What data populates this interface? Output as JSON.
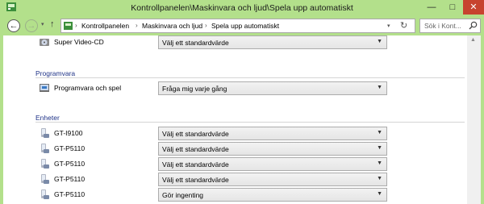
{
  "window": {
    "title": "Kontrollpanelen\\Maskinvara och ljud\\Spela upp automatiskt",
    "minimize_glyph": "—",
    "maximize_glyph": "□",
    "close_glyph": "✕"
  },
  "addressbar": {
    "back_glyph": "←",
    "forward_glyph": "→",
    "up_glyph": "↑",
    "crumbs": [
      "Kontrollpanelen",
      "Maskinvara och ljud",
      "Spela upp automatiskt"
    ],
    "search_placeholder": "Sök i Kont...",
    "refresh_glyph": "↻"
  },
  "sections": {
    "top_row": {
      "label": "Super Video-CD",
      "value": "Välj ett standardvärde",
      "icon": "super-video-cd-icon"
    },
    "software": {
      "title": "Programvara",
      "rows": [
        {
          "label": "Programvara och spel",
          "value": "Fråga mig varje gång",
          "icon": "software-icon"
        }
      ]
    },
    "devices": {
      "title": "Enheter",
      "rows": [
        {
          "label": "GT-I9100",
          "value": "Välj ett standardvärde",
          "icon": "device-icon"
        },
        {
          "label": "GT-P5110",
          "value": "Välj ett standardvärde",
          "icon": "device-icon"
        },
        {
          "label": "GT-P5110",
          "value": "Välj ett standardvärde",
          "icon": "device-icon"
        },
        {
          "label": "GT-P5110",
          "value": "Välj ett standardvärde",
          "icon": "device-icon"
        },
        {
          "label": "GT-P5110",
          "value": "Gör ingenting",
          "icon": "device-icon"
        }
      ]
    }
  },
  "colors": {
    "accent_green": "#b3e08b",
    "section_title": "#1e3287",
    "close_button": "#c7432e"
  }
}
